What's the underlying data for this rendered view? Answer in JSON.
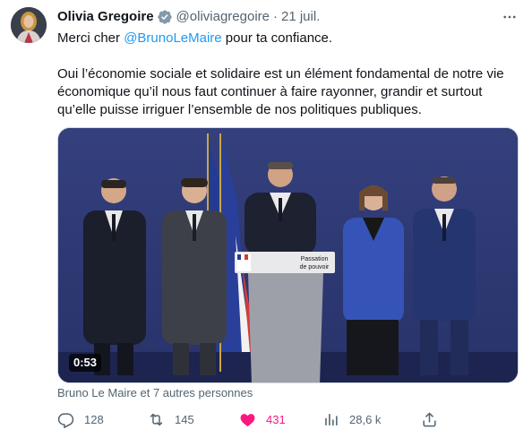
{
  "tweet": {
    "author_name": "Olivia Gregoire",
    "handle": "@oliviagregoire",
    "separator": "·",
    "date": "21 juil.",
    "text_line1_prefix": "Merci cher ",
    "mention": "@BrunoLeMaire",
    "text_line1_suffix": " pour ta confiance.",
    "text_paragraph2": "Oui l’économie sociale et solidaire est un élément fondamental de notre vie économique qu’il nous faut continuer à faire rayonner, grandir et surtout qu’elle puisse irriguer l’ensemble de nos politiques publiques.",
    "media": {
      "duration": "0:53",
      "podium_sign_line1": "Passation",
      "podium_sign_line2": "de pouvoir"
    },
    "tagged_people": "Bruno Le Maire et 7 autres personnes"
  },
  "actions": {
    "reply_count": "128",
    "retweet_count": "145",
    "like_count": "431",
    "views_count": "28,6 k"
  },
  "icons": {
    "verified": "verified-badge-icon",
    "more": "more-options-icon",
    "reply": "reply-icon",
    "retweet": "retweet-icon",
    "like": "heart-filled-icon",
    "views": "views-chart-icon",
    "share": "share-icon"
  },
  "colors": {
    "link": "#1d9bf0",
    "like": "#f91880",
    "muted": "#536471",
    "text": "#0f1419"
  }
}
